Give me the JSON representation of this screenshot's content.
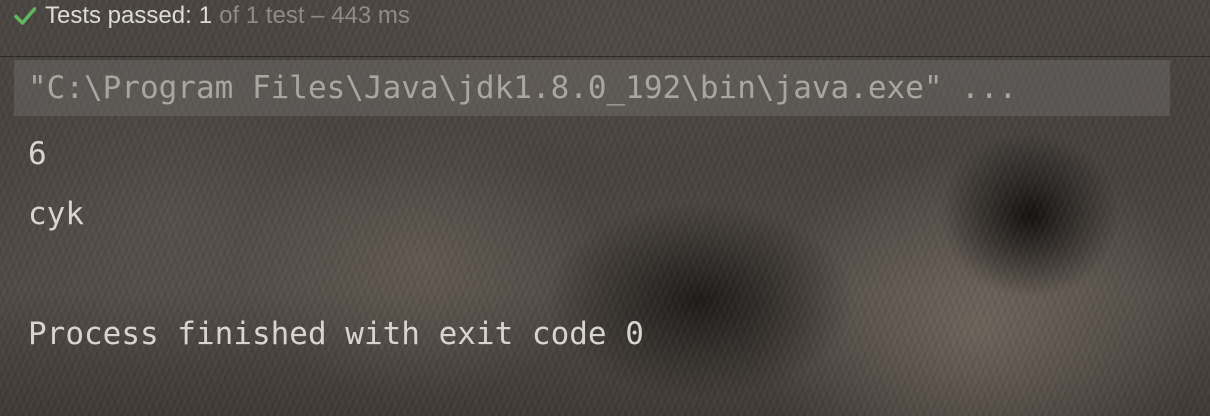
{
  "test_status": {
    "icon": "check-icon",
    "prefix": "Tests passed:",
    "count": "1",
    "detail": "of 1 test – 443 ms",
    "accent_color": "#4caf50"
  },
  "console": {
    "command": "\"C:\\Program Files\\Java\\jdk1.8.0_192\\bin\\java.exe\" ...",
    "output_lines": [
      "6",
      "cyk",
      "",
      "Process finished with exit code 0"
    ]
  }
}
